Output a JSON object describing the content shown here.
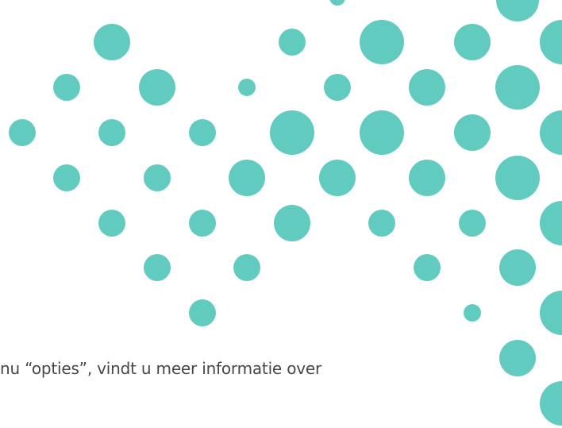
{
  "decoration": {
    "pattern": "circle-dot-grid",
    "dot_color": "#62CBBF",
    "background_color": "#FFFFFF"
  },
  "caption": {
    "text": "nu “opties”, vindt u meer informatie over",
    "color": "#474747"
  }
}
